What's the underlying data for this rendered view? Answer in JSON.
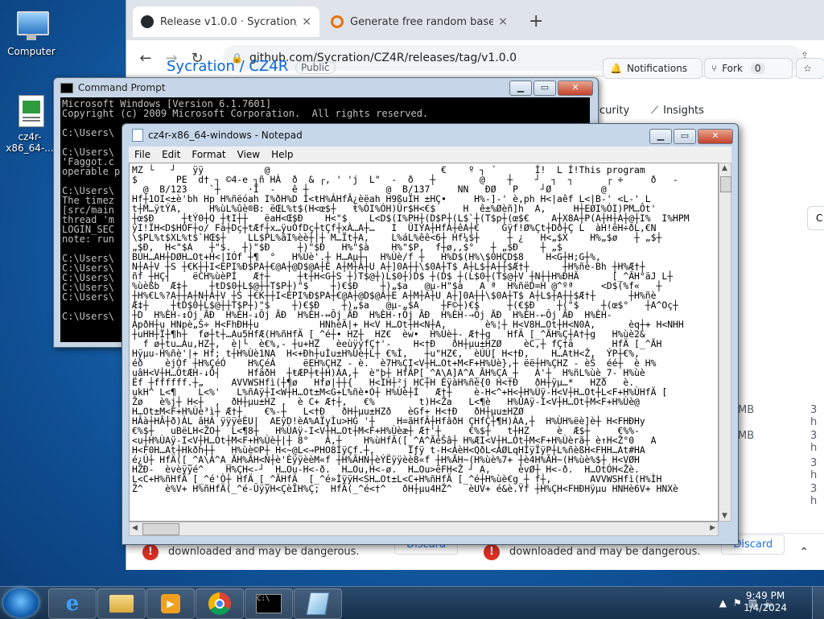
{
  "desktop": {
    "icons": [
      {
        "label": "Computer",
        "icon": "computer-icon"
      },
      {
        "label": "cz4r-x86_64-...",
        "icon": "notepad-file-icon"
      }
    ]
  },
  "browser": {
    "tabs": [
      {
        "title": "Release v1.0.0 · Sycration/CZ4R",
        "close": "×",
        "icon": "github-icon"
      },
      {
        "title": "Generate free random base64 str",
        "close": "×",
        "icon": "generator-site-icon"
      }
    ],
    "new_tab": "+",
    "url": "github.com/Sycration/CZ4R/releases/tag/v1.0.0",
    "repo_crumb": "Sycration / CZ4R",
    "visibility": "Public",
    "buttons": {
      "notifications": "Notifications",
      "fork": "Fork",
      "fork_count": "0"
    },
    "nav_tabs": {
      "security": "ecurity",
      "insights": "Insights"
    },
    "asset_sizes": [
      "MB",
      "MB",
      "",
      ""
    ],
    "asset_ages": [
      "3 h",
      "3 h",
      "3 h",
      "3 h"
    ],
    "downloads": [
      {
        "message": "downloaded and may be dangerous.",
        "action": "Discard"
      },
      {
        "message": "downloaded and may be dangerous.",
        "action": "Discard"
      }
    ]
  },
  "cmd": {
    "title": "Command Prompt",
    "lines": [
      "Microsoft Windows [Version 6.1.7601]",
      "Copyright (c) 2009 Microsoft Corporation.  All rights reserved.",
      "",
      "C:\\Users\\",
      "",
      "C:\\Users\\",
      "'Faggot.c",
      "operable p",
      "",
      "C:\\Users\\",
      "The timez",
      "[src/main",
      "thread 'm",
      "LOGIN_SEC",
      "note: run",
      "",
      "C:\\Users\\",
      "C:\\Users\\",
      "C:\\Users\\",
      "C:\\Users\\",
      "C:\\Users\\",
      "",
      "C:\\Users\\"
    ]
  },
  "notepad": {
    "title": "cz4r-x86_64-windows - Notepad",
    "menu": [
      "File",
      "Edit",
      "Format",
      "View",
      "Help"
    ],
    "lines": [
      "MZ └   ┘   ÿÿ           @                               €    º ┐ ´       Í!  L Í!This program",
      "$       PE  d† ┐ ©4-e ┐ñ HÀ  ð  & ┌, ' 'j  L\"  -  ð   ┼        @    ┼    ┘  ┐  ┐      ┌ ÷     ð   -",
      "  @  B/123    `┼     ·Ï  -   ê ┼              @  B/137     NN   ÐØ   P    ┘Ø         @",
      "Hf┼1OI<±è'bh Hp H%ñëóah I%ðH%D I<ŧH%ÁHfÂ¿èëah H9ßuÏH ±HÇ•     H%-]-' è,ph H<|aêf L<|B-' <L-' L",
      "t┼M…ÿtÝA,     H%ùL%ûè®B: ëŒL%t$(H<œ$┼   ŧ%ÒI%ÓH)Ûr$H<€$     H  ê±%Øèñ]h  A,     H┼EØI%ÓI)PM…Ôt'",
      "┼œ$Ð     ┼ŧÝ0┼Q ┼ŧI┼┼   ëaH<Œ$Ð    H<\"$    L<D$(I%PH┼(D$P┼(L$`┼(T$p┼(œ$€    A┼X8A┼P(A┼H┼A┼@┼I%  I%HPM",
      "ÿI!ÏH<D$HÓF┼o/ Fà┼Dç┼tÆf┼x…ÿuÒfDç┼tÇf┼xÀ…A┼…   I  ÜIÝA┼HfA┼êA┼€    Gÿf!Ø%Çt┼Dð┼Ç L  àH!ëH÷ðL,€N",
      "\\$PL%t$XL%t$`HŒ$┼    LL$PL%âI%èè┼|┼ M…Ït┼A,    L%áL%êê<6┼ Hf¼$┼     ┼ ¿   H<„$X    H%„$ø   ┼ „$┼",
      "„$Ð,  H<\"$A   ┼\"$.  ┼)\"$Ð     ┼)\"$Ð   H%\"$à    H%\"$P,  f┼ø,,$°   ┼ „$Ð    ┼ „$",
      "BÚH…AH┼DØH…Ot+H<|IÓf ┼¶  °   H%Ùè'.┼ H…Aµ┼┐  H%Ùè/f ┼   H%D$(H%\\$0HÇD$8    H<G┼H;G┼%,",
      "N┼A┼V ┼S ┼€K┼┼I<EPI%Ð$PA┼€@A┼@D$@A┼E A┼M┼A┼U A┼]0A┼┼\\$0A┼T$ A┼L$┼A┼┼$Æ†┼      ┼H%ñè-Bh ┼H%Æ†┼",
      "ñf ┼HÇ┤    ëCH%ùèPÍ   Æ†┼     ┼ŧ┼H<G┼S ┼)T$@┼)L$0┼)D$ ┼(D$ ┼(L$0┼(T$@┼V ┼N┼┼H%ÐHÄ      [_^ÃH°äJ L┼",
      "%ùèßb  Æ‡┼    ┼ŧD$0┼L$@┼┼T$P┼)\"$    ┼)€$Ð    ┼)„$a   @µ-H\"$à   A ª  H%ñëD=H @^ºª     <D$(%f«   ┼",
      "┼H%€L%?A┼┼A┼N┼A┼V ┼S ┼€K┼┼I<EPI%Ð$PA┼€@A┼@D$@A┼E A┼M┼A┼U A┼]0A┼┼\\$0A┼T$ A┼L$┼A┼┼$Æ†┼      ┼H%ñè",
      "Æ‡┼    ┼ŧD$0┼L$@┼┼T$P┼)\"$    ┼)€$Ð    ┼)„$a   @µ-„$A    ┼F©┼)€$     ┼(€$Ð    ┼(\"$    ┼(œ$°   ┼A^Oç┼",
      "┼D  H%ÈH-↕Ôj ÃÐ  H%ÈH-↓Ôj ÃÐ  H%ÈH-↔Ôj ÃÐ  H%ÈH-↑Ôj ÃÐ  H%ÈH-→Ôj ÃÐ  H%ÈH-←Ôj ÃÐ  H%ÈH-",
      "ApðH┼u HNpè„Š÷ H<FhÐH┼u           HNhèÄ|+ H<V H…Ot┼H<N┼A,       è%¦┼ H<V8H…Ot┼H<N0A,      èq┼+ H<NHH",
      "┼uHH┼Ï┼¶h┼  fø┼t┼…Au5HfÆ(H%ñHfÄ [_^é┼• HZ┼  HZ€  èw•  H%Ùè┼- Æ†┼g   HfÄ [_^ÃH%Ç┼A†┼g   H%ùè2&",
      "  f ø┼tu…Au,HZ┼,  è|└  è€%‚- ┼u+HZ   èeùÿýfÇ†'-    H<†Ð   ðH┼µu±HZØ    èC,┼ fÇ†ä       HfÄ [_^ÃH",
      "Hÿµu-H%ñè'|+ Hf; t┼H%Ùè1NA  H<+Ðh┼uÌu±H%Ùè┼L┼ €%Ì,   ┼u\"HZ€,  èÚÚ[ H<†Ð,    H…AtH<Ž,  ÝP┼€%,",
      "éð    èjÓf ┼H%ÇéÓ    H%ÇéÁ     ëEH%ÇHZ - è.  è7H%ÇI<V┼H…Ot+M<F+H%Ùè},┼ ëë┼H%ÇHZ - èŠ  éé┼  è H%",
      "uâH<V┼H…ÔtÆH-↓Ô┤     HfäðH  ┼ŧÆP┼ŧ┼H)ÁA,┼  è\"þ┼ HfÄP[_^A\\A]A^A_ÃH%ÇA_┼   A'┼  H%ñL%ùè_7- H%ùè",
      "Ëf ┼ffffff.┼„     AVVWSHfì(┼¶ø   Hfø|┼┼{   H<IH┼²j HC┼H ÉÿàH%ñè{0 H<†Ð   ðH┼ÿµ…*   HZð   è.",
      "ukH^ L<¶    L<%'   L%ñAÿ┼I<W┼H…Ot±M<G+L%ñè•Ó┼ H%Ùè┼Í   Æ†┼    è-H<^+H<┼H%Ùÿ-H<V┼H…Ot┼L<F+H%ÙHfÄ [",
      "Žø   è%j┼ H<┼  ,  ðH┼µu±HZ ,  è C+ Æ†┼,   €%        t)H<Ža   L<¶è   H%ÙAÿ-I<V┼H…Ot┼M<F+H%Ùè@",
      "H…Ot±M<F+H%Ùè³ì┼ Æ†┼    €%-┼   L<†Ð   ðH┼µu±HZð   èGf+ H<†Ð   ðH┼µu±HZØ    ",
      "HÂà┼HÂ┼ð)ÀL âHÁ ÿÿÿèÈU|  AEÿD!èA%AÏyÌu>HG '┼    H=ãHfÂ┼HfâðH ÇHfÇ┼¶H)ÀA,┼  H%ÙH%ëè]è┼ H<FHÐHy",
      "€%$┼   uBëLH<ŽO┼  L<¶8┼   H%ÙAÿ-I<V┼H…Ot┼M<F+H%Ùèæ┼ Æ†'┼     €%$┼   t┼HZ     è  Æ$┼     €%%-",
      "<u┼H%ÙAÿ-I<V┼H…Ot┼M<F+H%Ùè┼|┼ 8°   A,┼    H%ùHfÄ([_^A^ÃéŠâ┼ H%ÆI<V┼H…Ot┼M<F+H%Ùèrã┼ è↑H<Ž°0   A",
      "H<F0H…At┼Hkðh┼┼   H%ùè©P┼ H<~@L<→PHO8IÿÇf.┼,      Iƒÿ t-H<AèH<QðL<AØLqHIÿÏÿP┼L%ñèßH<FHH…At#HA",
      "é¿Ú┼ HfÄ([_^A\\A^A_ÃH%ÃH<N┼è'ÈÿÿèèM«f ┼H%ÃHN┼èÝËÿÿèè8«f ┼H%ÃH~(H%ùè%7+ ┼è4H%ÃH~(H%ùè%$┼ H<VØH",
      "HZÐ-  èvèÿÿé^    H%ÇH<-┘  H…Ou-H<-ð.  H…Ou,H<-ø.  H…Ou>ëFH<Ž ┘ A,     èvØ┼ H<-ð.  H…OtÓH<Žè.",
      "L<C+H%ñHfÄ [_^é'Ò┼ HfÄ [_^ÃHfÄ  [_^é»ÌÿÿH<SH…Ot±L<C+H%ñHfÄ [_^é┼H%ùè€g ┼ f┼,       AVVWSHfì(H%ÌH",
      "Ž^    è%V+ H%ñHfÄ(_^é-ÛÿÿH<ÇèÎH%Ç;  HfÄ(_^é<†^   ðH┼µu4HŽ^   èUV+ é&è.Ÿf ┼H%ÇH<FHÐHÿµu HNHè6V+ HNXè"
    ]
  },
  "taskbar": {
    "apps": [
      "start-orb",
      "internet-explorer-icon",
      "file-explorer-icon",
      "media-player-icon",
      "chrome-icon",
      "cmd-icon",
      "notepad-icon"
    ],
    "time": "9:49 PM",
    "date": "1/4/2024"
  }
}
